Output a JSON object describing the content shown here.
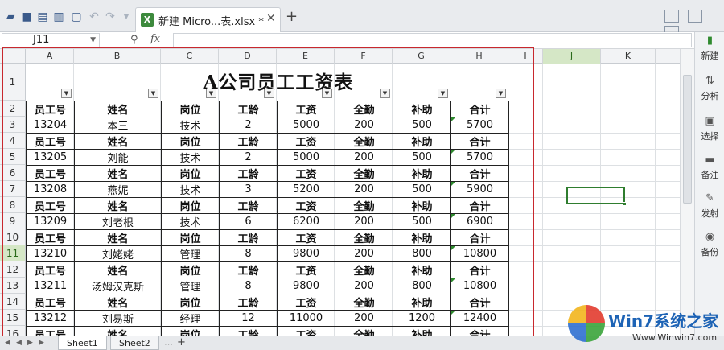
{
  "tab": {
    "title": "新建 Micro...表.xlsx *",
    "file_icon": "X"
  },
  "formula_bar": {
    "cell_ref": "J11",
    "fx_label": "fx",
    "formula": ""
  },
  "columns": [
    "A",
    "B",
    "C",
    "D",
    "E",
    "F",
    "G",
    "H",
    "I",
    "J",
    "K"
  ],
  "rows": [
    "1",
    "2",
    "3",
    "4",
    "5",
    "6",
    "7",
    "8",
    "9",
    "10",
    "11",
    "12",
    "13",
    "14",
    "15",
    "16"
  ],
  "selected": {
    "column": "J",
    "row": "11"
  },
  "sheet": {
    "title": "A公司员工工资表",
    "header": [
      "员工号",
      "姓名",
      "岗位",
      "工龄",
      "工资",
      "全勤",
      "补助",
      "合计"
    ],
    "records": [
      [
        "13204",
        "本三",
        "技术",
        "2",
        "5000",
        "200",
        "500",
        "5700"
      ],
      [
        "13205",
        "刘能",
        "技术",
        "2",
        "5000",
        "200",
        "500",
        "5700"
      ],
      [
        "13208",
        "燕妮",
        "技术",
        "3",
        "5200",
        "200",
        "500",
        "5900"
      ],
      [
        "13209",
        "刘老根",
        "技术",
        "6",
        "6200",
        "200",
        "500",
        "6900"
      ],
      [
        "13210",
        "刘姥姥",
        "管理",
        "8",
        "9800",
        "200",
        "800",
        "10800"
      ],
      [
        "13211",
        "汤姆汉克斯",
        "管理",
        "8",
        "9800",
        "200",
        "800",
        "10800"
      ],
      [
        "13212",
        "刘易斯",
        "经理",
        "12",
        "11000",
        "200",
        "1200",
        "12400"
      ]
    ]
  },
  "right_panel": [
    {
      "label": "新建",
      "icon": "new-icon"
    },
    {
      "label": "分析",
      "icon": "analyze-icon"
    },
    {
      "label": "选择",
      "icon": "select-icon"
    },
    {
      "label": "备注",
      "icon": "comment-icon"
    },
    {
      "label": "发射",
      "icon": "send-icon"
    },
    {
      "label": "备份",
      "icon": "backup-icon"
    }
  ],
  "sheet_tabs": [
    "Sheet1",
    "Sheet2"
  ],
  "watermark": {
    "brand": "Win7系统之家",
    "url": "Www.Winwin7.com"
  },
  "colors": {
    "accent_green": "#2f7d2f",
    "highlight_red": "#c8282e"
  }
}
